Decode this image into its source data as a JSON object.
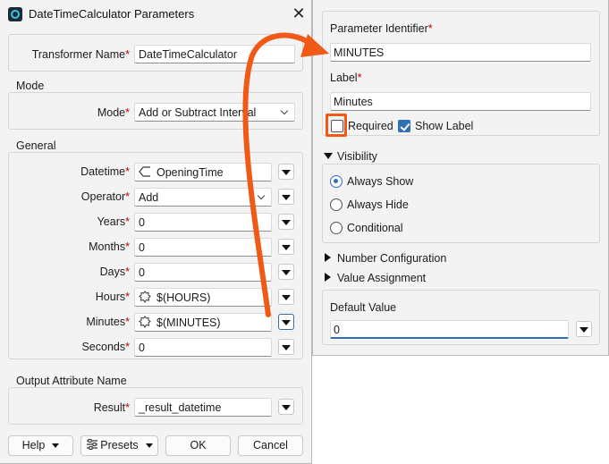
{
  "window": {
    "title": "DateTimeCalculator Parameters",
    "close_glyph": "✕"
  },
  "transformer": {
    "label": "Transformer Name",
    "value": "DateTimeCalculator"
  },
  "mode": {
    "group_title": "Mode",
    "label": "Mode",
    "value": "Add or Subtract Interval"
  },
  "general": {
    "group_title": "General",
    "rows": [
      {
        "label": "Datetime",
        "value": "OpeningTime",
        "icon": "attribute-icon"
      },
      {
        "label": "Operator",
        "value": "Add",
        "icon": ""
      },
      {
        "label": "Years",
        "value": "0",
        "icon": ""
      },
      {
        "label": "Months",
        "value": "0",
        "icon": ""
      },
      {
        "label": "Days",
        "value": "0",
        "icon": ""
      },
      {
        "label": "Hours",
        "value": "$(HOURS)",
        "icon": "user-parameter-icon"
      },
      {
        "label": "Minutes",
        "value": "$(MINUTES)",
        "icon": "user-parameter-icon"
      },
      {
        "label": "Seconds",
        "value": "0",
        "icon": ""
      }
    ]
  },
  "output": {
    "group_title": "Output Attribute Name",
    "label": "Result",
    "value": "_result_datetime"
  },
  "buttons": {
    "help": "Help",
    "presets": "Presets",
    "ok": "OK",
    "cancel": "Cancel"
  },
  "required_marker": "*",
  "panel": {
    "identifier_label": "Parameter Identifier",
    "identifier_value": "MINUTES",
    "label_label": "Label",
    "label_value": "Minutes",
    "required_label": "Required",
    "required_checked": false,
    "show_label_label": "Show Label",
    "show_label_checked": true,
    "visibility": {
      "title": "Visibility",
      "options": [
        "Always Show",
        "Always Hide",
        "Conditional"
      ],
      "selected": "Always Show"
    },
    "number_configuration": "Number Configuration",
    "value_assignment": "Value Assignment",
    "default_value_label": "Default Value",
    "default_value": "0"
  },
  "colors": {
    "accent": "#2f6fb5",
    "annotation": "#f05a16",
    "required": "#c00000"
  }
}
